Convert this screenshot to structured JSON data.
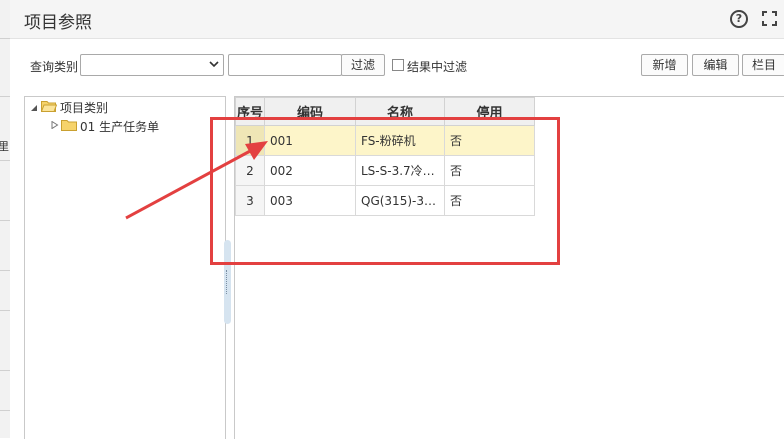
{
  "background": {
    "fragment": "里"
  },
  "dialog": {
    "title": "项目参照",
    "help_glyph": "?"
  },
  "toolbar": {
    "category_label": "查询类别",
    "category_value": "",
    "filter_value": "",
    "filter_button": "过滤",
    "filter_in_results_label": "结果中过滤",
    "filter_in_results_checked": false,
    "add_button": "新增",
    "edit_button": "编辑",
    "columns_button": "栏目"
  },
  "tree": {
    "root": {
      "label": "项目类别",
      "expanded": true
    },
    "children": [
      {
        "label": "01 生产任务单",
        "expanded": false
      }
    ]
  },
  "grid": {
    "columns": [
      "序号",
      "编码",
      "名称",
      "停用"
    ],
    "rows": [
      {
        "index": "1",
        "code": "001",
        "name": "FS-粉碎机",
        "disabled": "否",
        "selected": true
      },
      {
        "index": "2",
        "code": "002",
        "name": "LS-S-3.7冷…",
        "disabled": "否",
        "selected": false
      },
      {
        "index": "3",
        "code": "003",
        "name": "QG(315)-3…",
        "disabled": "否",
        "selected": false
      }
    ]
  },
  "annotation": {
    "color": "#e34040"
  },
  "colors": {
    "selected_row": "#fdf5c9",
    "header_bg": "#f0f0f0",
    "splitter": "#d6e4f0"
  }
}
